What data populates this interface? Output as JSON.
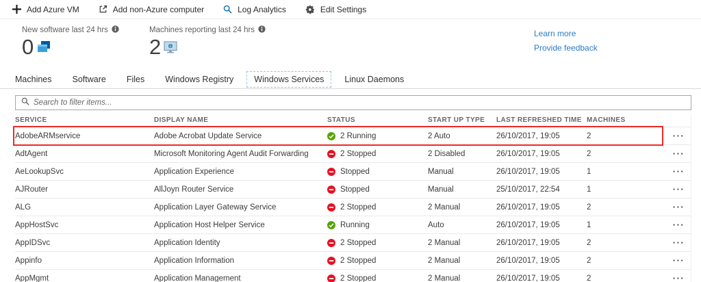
{
  "toolbar": {
    "items": [
      {
        "icon": "plus-icon",
        "label": "Add Azure VM"
      },
      {
        "icon": "external-link-icon",
        "label": "Add non-Azure computer"
      },
      {
        "icon": "search-icon",
        "label": "Log Analytics"
      },
      {
        "icon": "gear-icon",
        "label": "Edit Settings"
      }
    ]
  },
  "stats": [
    {
      "label": "New software last 24 hrs",
      "value": "0",
      "icon": "software-icon"
    },
    {
      "label": "Machines reporting last 24 hrs",
      "value": "2",
      "icon": "machines-icon"
    }
  ],
  "links": [
    {
      "label": "Learn more"
    },
    {
      "label": "Provide feedback"
    }
  ],
  "tabs": [
    {
      "label": "Machines",
      "selected": false
    },
    {
      "label": "Software",
      "selected": false
    },
    {
      "label": "Files",
      "selected": false
    },
    {
      "label": "Windows Registry",
      "selected": false
    },
    {
      "label": "Windows Services",
      "selected": true
    },
    {
      "label": "Linux Daemons",
      "selected": false
    }
  ],
  "search": {
    "placeholder": "Search to filter items..."
  },
  "icons": {
    "more_options": "···"
  },
  "colors": {
    "accent_blue": "#2b7bc4",
    "status_green": "#57a300",
    "status_red": "#e81123",
    "highlight_red": "#ea2a25"
  },
  "table": {
    "columns": [
      "SERVICE",
      "DISPLAY NAME",
      "STATUS",
      "START UP TYPE",
      "LAST REFRESHED TIME",
      "MACHINES"
    ],
    "rows": [
      {
        "service": "AdobeARMservice",
        "display_name": "Adobe Acrobat Update Service",
        "status": {
          "state": "running",
          "label": "2 Running"
        },
        "startup": "2 Auto",
        "refreshed": "26/10/2017, 19:05",
        "machines": "2",
        "highlighted": true
      },
      {
        "service": "AdtAgent",
        "display_name": "Microsoft Monitoring Agent Audit Forwarding",
        "status": {
          "state": "stopped",
          "label": "2 Stopped"
        },
        "startup": "2 Disabled",
        "refreshed": "26/10/2017, 19:05",
        "machines": "2",
        "highlighted": false
      },
      {
        "service": "AeLookupSvc",
        "display_name": "Application Experience",
        "status": {
          "state": "stopped",
          "label": "Stopped"
        },
        "startup": "Manual",
        "refreshed": "26/10/2017, 19:05",
        "machines": "1",
        "highlighted": false
      },
      {
        "service": "AJRouter",
        "display_name": "AllJoyn Router Service",
        "status": {
          "state": "stopped",
          "label": "Stopped"
        },
        "startup": "Manual",
        "refreshed": "25/10/2017, 22:54",
        "machines": "1",
        "highlighted": false
      },
      {
        "service": "ALG",
        "display_name": "Application Layer Gateway Service",
        "status": {
          "state": "stopped",
          "label": "2 Stopped"
        },
        "startup": "2 Manual",
        "refreshed": "26/10/2017, 19:05",
        "machines": "2",
        "highlighted": false
      },
      {
        "service": "AppHostSvc",
        "display_name": "Application Host Helper Service",
        "status": {
          "state": "running",
          "label": "Running"
        },
        "startup": "Auto",
        "refreshed": "26/10/2017, 19:05",
        "machines": "1",
        "highlighted": false
      },
      {
        "service": "AppIDSvc",
        "display_name": "Application Identity",
        "status": {
          "state": "stopped",
          "label": "2 Stopped"
        },
        "startup": "2 Manual",
        "refreshed": "26/10/2017, 19:05",
        "machines": "2",
        "highlighted": false
      },
      {
        "service": "Appinfo",
        "display_name": "Application Information",
        "status": {
          "state": "stopped",
          "label": "2 Stopped"
        },
        "startup": "2 Manual",
        "refreshed": "26/10/2017, 19:05",
        "machines": "2",
        "highlighted": false
      },
      {
        "service": "AppMgmt",
        "display_name": "Application Management",
        "status": {
          "state": "stopped",
          "label": "2 Stopped"
        },
        "startup": "2 Manual",
        "refreshed": "26/10/2017, 19:05",
        "machines": "2",
        "highlighted": false
      }
    ]
  }
}
